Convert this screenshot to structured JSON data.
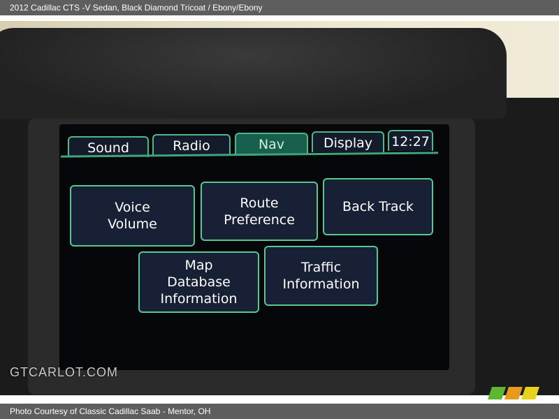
{
  "header": {
    "title": "2012 Cadillac CTS -V Sedan,  Black Diamond Tricoat / Ebony/Ebony"
  },
  "screen": {
    "tabs": [
      {
        "label": "Sound"
      },
      {
        "label": "Radio"
      },
      {
        "label": "Nav",
        "active": true
      },
      {
        "label": "Display"
      }
    ],
    "clock": "12:27",
    "buttons": [
      {
        "label": "Voice\nVolume"
      },
      {
        "label": "Route\nPreference"
      },
      {
        "label": "Back Track"
      },
      {
        "label": "Map\nDatabase\nInformation"
      },
      {
        "label": "Traffic\nInformation"
      }
    ],
    "colors": {
      "accent": "#57c890",
      "button_bg": "#172034",
      "active_tab": "#17604e"
    }
  },
  "watermark": {
    "logo": "GTCARLOT.COM"
  },
  "footer": {
    "caption": "Photo Courtesy of Classic Cadillac Saab - Mentor, OH"
  }
}
